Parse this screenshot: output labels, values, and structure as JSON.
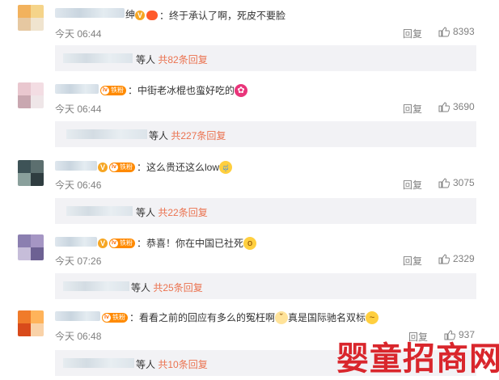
{
  "comments": [
    {
      "name_suffix": "绅",
      "text": "：终于承认了啊，死皮不要脸",
      "time": "今天 06:44",
      "reply_label": "回复",
      "likes": "8393",
      "sub_people": "等人",
      "sub_link": "共82条回复",
      "avatar_colors": [
        "#f2b25d",
        "#f5d48a",
        "#e6c8a1",
        "#f0e4cf"
      ]
    },
    {
      "fan_badge": "铁粉",
      "text": "：中街老冰棍也蛮好吃的",
      "time": "今天 06:44",
      "reply_label": "回复",
      "likes": "3690",
      "sub_people": "等人",
      "sub_link": "共227条回复",
      "avatar_colors": [
        "#e9c7cf",
        "#f3dde3",
        "#c9a7b0",
        "#efe6e8"
      ]
    },
    {
      "fan_badge": "铁粉",
      "text": "：这么贵还这么low",
      "time": "今天 06:46",
      "reply_label": "回复",
      "likes": "3075",
      "sub_people": "等人",
      "sub_link": "共22条回复",
      "avatar_colors": [
        "#3e5357",
        "#5c6f6f",
        "#8aa09c",
        "#2f3d40"
      ]
    },
    {
      "fan_badge": "铁粉",
      "text": "：恭喜！你在中国已社死",
      "time": "今天 07:26",
      "reply_label": "回复",
      "likes": "2329",
      "sub_people": "等人",
      "sub_link": "共25条回复",
      "avatar_colors": [
        "#8b7fb0",
        "#a596c4",
        "#c6bdd9",
        "#6d6193"
      ]
    },
    {
      "fan_badge": "铁粉",
      "text": "：看看之前的回应有多么的冤枉啊",
      "text2": "真是国际驰名双标",
      "time": "今天 06:48",
      "reply_label": "回复",
      "likes": "937",
      "sub_people": "等人",
      "sub_link": "共10条回复",
      "avatar_colors": [
        "#f07b2a",
        "#ffb35a",
        "#d84a1b",
        "#f9d2a8"
      ]
    }
  ],
  "watermark": "婴童招商网",
  "colors": {
    "link": "#eb7350",
    "meta": "#808080",
    "subbox": "#f2f2f5",
    "watermark": "#d9262c"
  }
}
